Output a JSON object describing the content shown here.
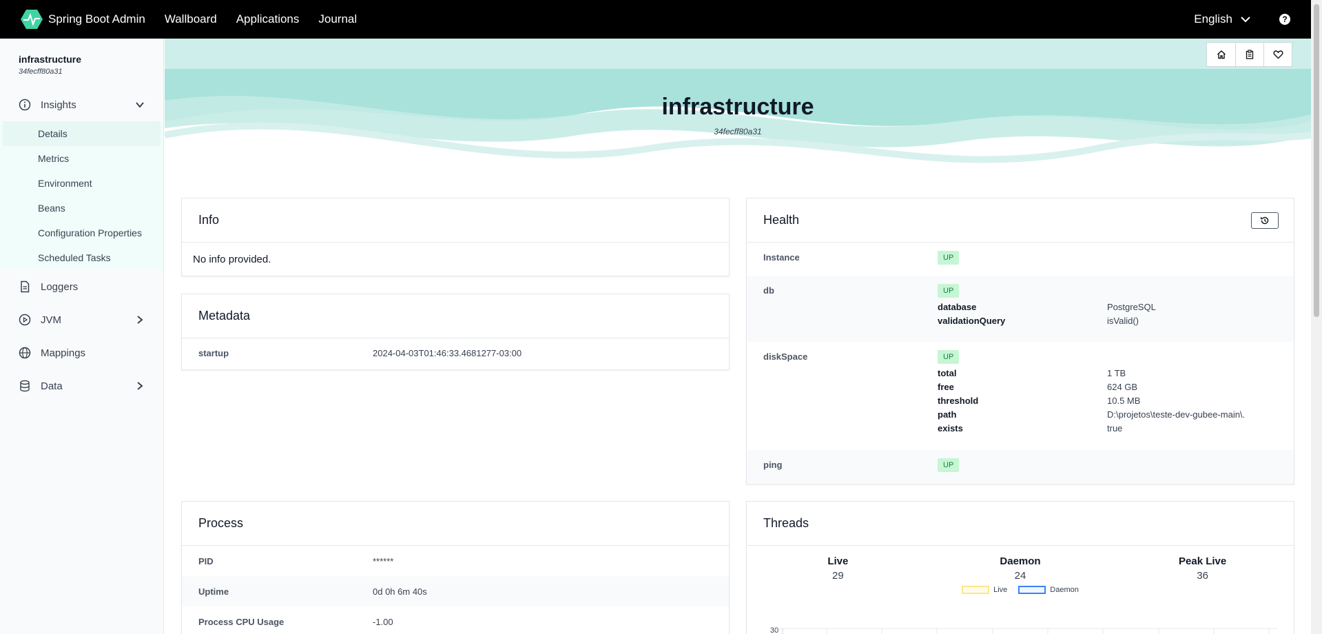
{
  "nav": {
    "brand": "Spring Boot Admin",
    "links": [
      "Wallboard",
      "Applications",
      "Journal"
    ],
    "language": "English",
    "help_label": "?"
  },
  "sidebar": {
    "app_name": "infrastructure",
    "app_id": "34fecff80a31",
    "insights_label": "Insights",
    "sub_items": [
      "Details",
      "Metrics",
      "Environment",
      "Beans",
      "Configuration Properties",
      "Scheduled Tasks"
    ],
    "loggers_label": "Loggers",
    "jvm_label": "JVM",
    "mappings_label": "Mappings",
    "data_label": "Data"
  },
  "hero": {
    "title": "infrastructure",
    "subtitle": "34fecff80a31"
  },
  "info": {
    "title": "Info",
    "empty": "No info provided."
  },
  "metadata": {
    "title": "Metadata",
    "key": "startup",
    "value": "2024-04-03T01:46:33.4681277-03:00"
  },
  "health": {
    "title": "Health",
    "instance_label": "Instance",
    "instance_status": "UP",
    "db_label": "db",
    "db_status": "UP",
    "db_details": [
      {
        "k": "database",
        "v": "PostgreSQL"
      },
      {
        "k": "validationQuery",
        "v": "isValid()"
      }
    ],
    "disk_label": "diskSpace",
    "disk_status": "UP",
    "disk_details": [
      {
        "k": "total",
        "v": "1 TB"
      },
      {
        "k": "free",
        "v": "624 GB"
      },
      {
        "k": "threshold",
        "v": "10.5 MB"
      },
      {
        "k": "path",
        "v": "D:\\projetos\\teste-dev-gubee-main\\."
      },
      {
        "k": "exists",
        "v": "true"
      }
    ],
    "ping_label": "ping",
    "ping_status": "UP"
  },
  "process": {
    "title": "Process",
    "rows": [
      {
        "k": "PID",
        "v": "******"
      },
      {
        "k": "Uptime",
        "v": "0d 0h 6m 40s"
      },
      {
        "k": "Process CPU Usage",
        "v": "-1.00"
      }
    ]
  },
  "threads": {
    "title": "Threads",
    "live_label": "Live",
    "live_value": "29",
    "daemon_label": "Daemon",
    "daemon_value": "24",
    "peak_label": "Peak Live",
    "peak_value": "36",
    "legend_live": "Live",
    "legend_daemon": "Daemon",
    "y_tick": "30",
    "colors": {
      "live": "#fde68a",
      "daemon": "#3b82f6"
    }
  }
}
